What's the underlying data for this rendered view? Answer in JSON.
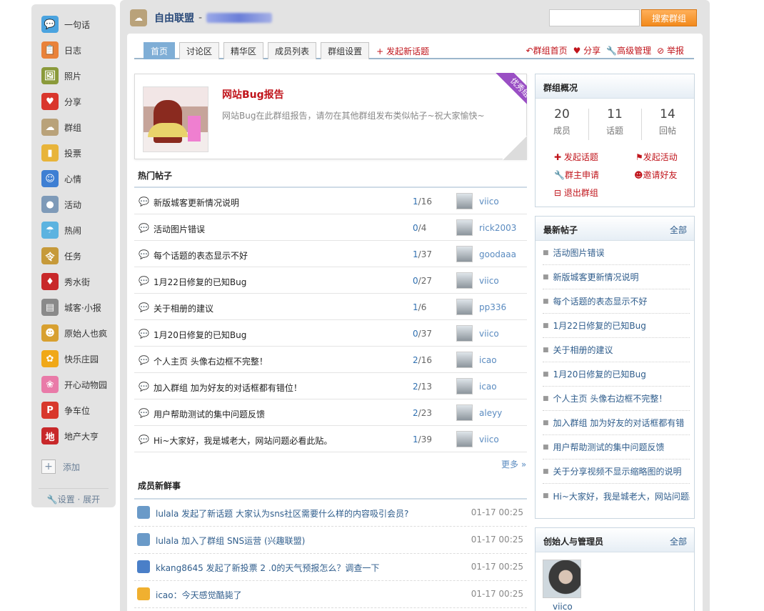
{
  "sidebar": {
    "apps": [
      {
        "label": "一句话",
        "icon": "speech-icon",
        "color": "#4aa3df",
        "glyph": "💬"
      },
      {
        "label": "日志",
        "icon": "notebook-icon",
        "color": "#e9823a",
        "glyph": "📋"
      },
      {
        "label": "照片",
        "icon": "photo-icon",
        "color": "#8a9a3a",
        "glyph": "🖼"
      },
      {
        "label": "分享",
        "icon": "heart-icon",
        "color": "#d9362c",
        "glyph": "♥"
      },
      {
        "label": "群组",
        "icon": "group-icon",
        "color": "#b9a27a",
        "glyph": "☁"
      },
      {
        "label": "投票",
        "icon": "vote-icon",
        "color": "#e8b43a",
        "glyph": "▮"
      },
      {
        "label": "心情",
        "icon": "mood-icon",
        "color": "#3e7fd3",
        "glyph": "☺"
      },
      {
        "label": "活动",
        "icon": "event-icon",
        "color": "#7e9ab8",
        "glyph": "●"
      },
      {
        "label": "热闹",
        "icon": "lively-icon",
        "color": "#5cb3e0",
        "glyph": "☂"
      },
      {
        "label": "任务",
        "icon": "task-icon",
        "color": "#c69a3a",
        "glyph": "令"
      },
      {
        "label": "秀水街",
        "icon": "market-icon",
        "color": "#c8282a",
        "glyph": "♦"
      },
      {
        "label": "城客·小报",
        "icon": "newspaper-icon",
        "color": "#8a8a8a",
        "glyph": "▤"
      },
      {
        "label": "原始人也疯",
        "icon": "caveman-icon",
        "color": "#d8a030",
        "glyph": "☻"
      },
      {
        "label": "快乐庄园",
        "icon": "farm-icon",
        "color": "#f0a818",
        "glyph": "✿"
      },
      {
        "label": "开心动物园",
        "icon": "zoo-icon",
        "color": "#e97aa8",
        "glyph": "❀"
      },
      {
        "label": "争车位",
        "icon": "parking-icon",
        "color": "#d8382c",
        "glyph": "P"
      },
      {
        "label": "地产大亨",
        "icon": "estate-icon",
        "color": "#c8282a",
        "glyph": "地"
      }
    ],
    "add_label": "添加",
    "footer": "🔧设置 · 展开"
  },
  "group": {
    "name": "自由联盟",
    "dash": "-"
  },
  "search": {
    "placeholder": "",
    "button": "搜索群组"
  },
  "tabs": [
    {
      "label": "首页",
      "active": true
    },
    {
      "label": "讨论区",
      "active": false
    },
    {
      "label": "精华区",
      "active": false
    },
    {
      "label": "成员列表",
      "active": false
    },
    {
      "label": "群组设置",
      "active": false
    }
  ],
  "new_topic": "+ 发起新话题",
  "tab_actions": [
    "↶群组首页",
    "♥ 分享",
    "🔧高级管理",
    "⊘ 举报"
  ],
  "featured": {
    "title": "网站Bug报告",
    "desc": "网站Bug在此群组报告，请勿在其他群组发布类似帖子~祝大家愉快~",
    "ribbon": "优秀组"
  },
  "hot_posts_title": "热门帖子",
  "hot_posts": [
    {
      "title": "新版城客更新情况说明",
      "replies": "1",
      "views": "16",
      "user": "viico"
    },
    {
      "title": "活动图片错误",
      "replies": "0",
      "views": "4",
      "user": "rick2003"
    },
    {
      "title": "每个话题的表态显示不好",
      "replies": "1",
      "views": "37",
      "user": "goodaaa"
    },
    {
      "title": "1月22日修复的已知Bug",
      "replies": "0",
      "views": "27",
      "user": "viico"
    },
    {
      "title": "关于相册的建议",
      "replies": "1",
      "views": "6",
      "user": "pp336"
    },
    {
      "title": "1月20日修复的已知Bug",
      "replies": "0",
      "views": "37",
      "user": "viico"
    },
    {
      "title": "个人主页 头像右边框不完整！",
      "replies": "2",
      "views": "16",
      "user": "icao"
    },
    {
      "title": "加入群组 加为好友的对话框都有错位！",
      "replies": "2",
      "views": "13",
      "user": "icao"
    },
    {
      "title": "用户帮助测试的集中问题反馈",
      "replies": "2",
      "views": "23",
      "user": "aleyy"
    },
    {
      "title": "Hi~大家好，我是城老大，网站问题必看此贴。",
      "replies": "1",
      "views": "39",
      "user": "viico"
    }
  ],
  "more": "更多 »",
  "news_title": "成员新鲜事",
  "news": [
    {
      "text": "lulala 发起了新话题 大家认为sns社区需要什么样的内容吸引会员?",
      "time": "01-17 00:25",
      "color": "#6a9ac8"
    },
    {
      "text": "lulala 加入了群组 SNS运营 (兴趣联盟)",
      "time": "01-17 00:25",
      "color": "#6a9ac8"
    },
    {
      "text": "kkang8645 发起了新投票 2 .0的天气预报怎么？调查一下",
      "time": "01-17 00:25",
      "color": "#4a7fc8"
    },
    {
      "text": "icao：今天感觉酷毙了",
      "time": "01-17 00:25",
      "color": "#f0b030"
    }
  ],
  "overview": {
    "title": "群组概况",
    "stats": [
      {
        "num": "20",
        "label": "成员"
      },
      {
        "num": "11",
        "label": "话题"
      },
      {
        "num": "14",
        "label": "回帖"
      }
    ],
    "actions": [
      "✚ 发起话题",
      "⚑发起活动",
      "🔧群主申请",
      "☻邀请好友",
      "⊟ 退出群组"
    ]
  },
  "latest": {
    "title": "最新帖子",
    "more": "全部",
    "items": [
      "活动图片错误",
      "新版城客更新情况说明",
      "每个话题的表态显示不好",
      "1月22日修复的已知Bug",
      "关于相册的建议",
      "1月20日修复的已知Bug",
      "个人主页 头像右边框不完整！",
      "加入群组 加为好友的对话框都有错",
      "用户帮助测试的集中问题反馈",
      "关于分享视频不显示缩略图的说明",
      "Hi~大家好，我是城老大，网站问题必"
    ]
  },
  "admins": {
    "title": "创始人与管理员",
    "more": "全部",
    "name": "viico"
  }
}
